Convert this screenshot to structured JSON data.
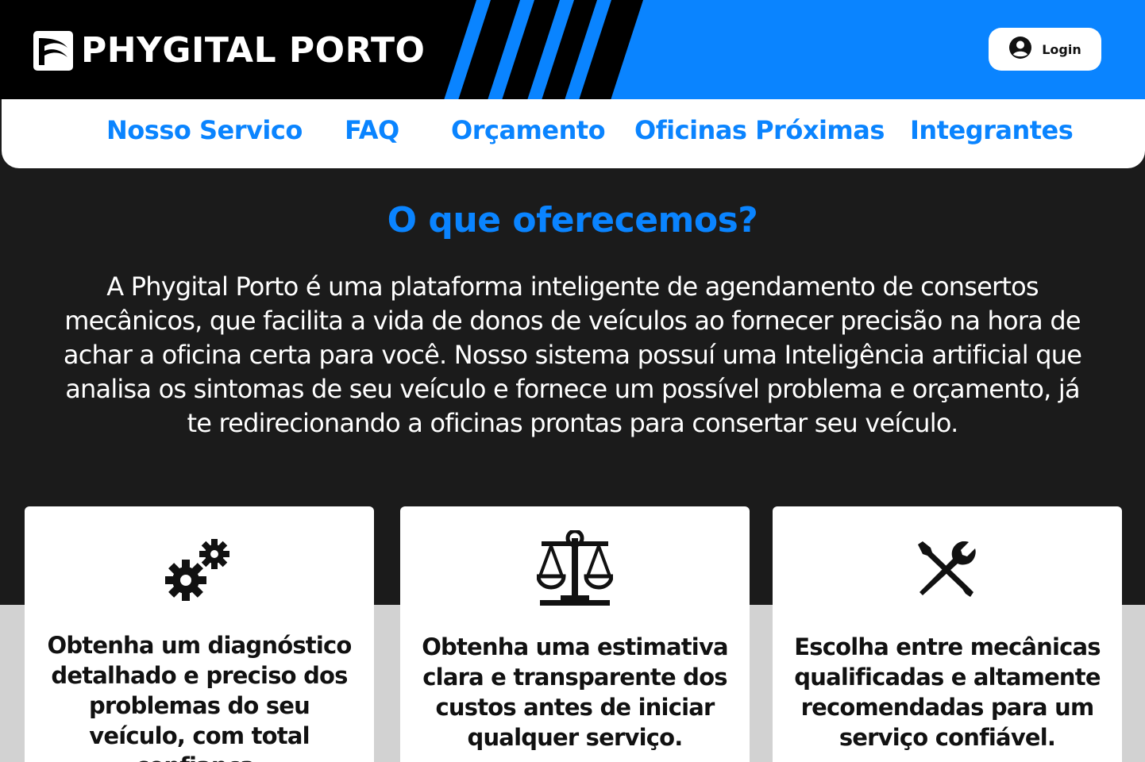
{
  "header": {
    "brand": "PHYGITAL PORTO",
    "login_label": "Login"
  },
  "nav": {
    "items": [
      {
        "label": "Nosso Servico"
      },
      {
        "label": "FAQ"
      },
      {
        "label": "Orçamento"
      },
      {
        "label": "Oficinas Próximas"
      },
      {
        "label": "Integrantes"
      }
    ]
  },
  "main": {
    "title": "O que oferecemos?",
    "intro": "A Phygital Porto é uma plataforma inteligente de agendamento de consertos mecânicos, que facilita a vida de donos de veículos ao fornecer precisão na hora de achar a oficina certa para você. Nosso sistema possuí uma Inteligência artificial que analisa os sintomas de seu veículo e fornece um possível problema e orçamento, já te redirecionando a oficinas prontas para consertar seu veículo."
  },
  "cards": [
    {
      "icon": "gears-icon",
      "text": "Obtenha um diagnóstico detalhado e preciso dos problemas do seu veículo, com total confiança."
    },
    {
      "icon": "scale-icon",
      "text": "Obtenha uma estimativa clara e transparente dos custos antes de iniciar qualquer serviço."
    },
    {
      "icon": "tools-icon",
      "text": "Escolha entre mecânicas qualificadas e altamente recomendadas para um serviço confiável."
    }
  ],
  "colors": {
    "accent": "#0a84ff",
    "header_bg": "#000000",
    "page_bg": "#1b1b1b",
    "band_bg": "#d2d2d2"
  }
}
